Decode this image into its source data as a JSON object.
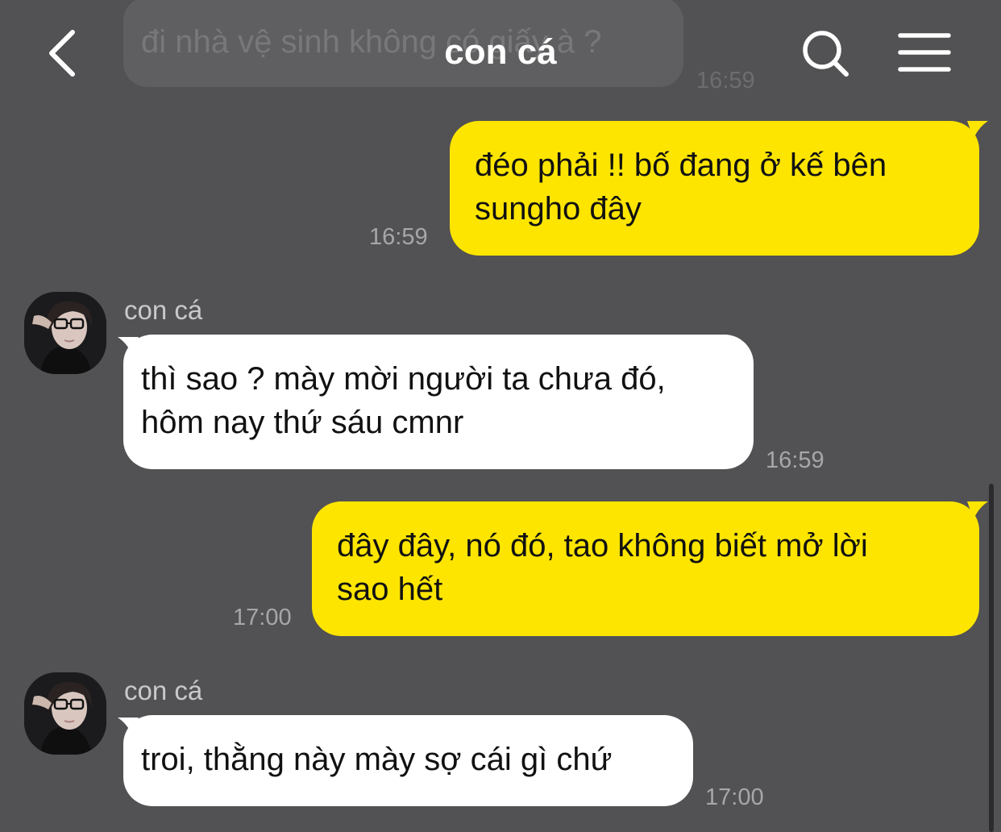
{
  "header": {
    "title": "con cá",
    "back_icon": "chevron-left-icon",
    "search_icon": "search-icon",
    "menu_icon": "hamburger-menu-icon"
  },
  "colors": {
    "background": "#525153",
    "outgoing_bubble": "#fee500",
    "incoming_bubble": "#ffffff",
    "timestamp": "#a7a6a9"
  },
  "previous_message": {
    "text": "đi nhà vệ sinh không có giấy à ?",
    "time": "16:59"
  },
  "messages": [
    {
      "direction": "out",
      "lines": [
        "đéo phải !! bố đang ở kế bên",
        "sungho đây"
      ],
      "time": "16:59"
    },
    {
      "direction": "in",
      "sender": "con cá",
      "lines": [
        "thì sao ? mày mời người ta chưa đó,",
        "hôm nay thứ sáu cmnr"
      ],
      "time": "16:59"
    },
    {
      "direction": "out",
      "lines": [
        "đây đây, nó đó, tao không biết mở lời",
        "sao hết"
      ],
      "time": "17:00"
    },
    {
      "direction": "in",
      "sender": "con cá",
      "lines": [
        "troi, thằng này mày sợ cái gì chứ"
      ],
      "time": "17:00"
    }
  ]
}
